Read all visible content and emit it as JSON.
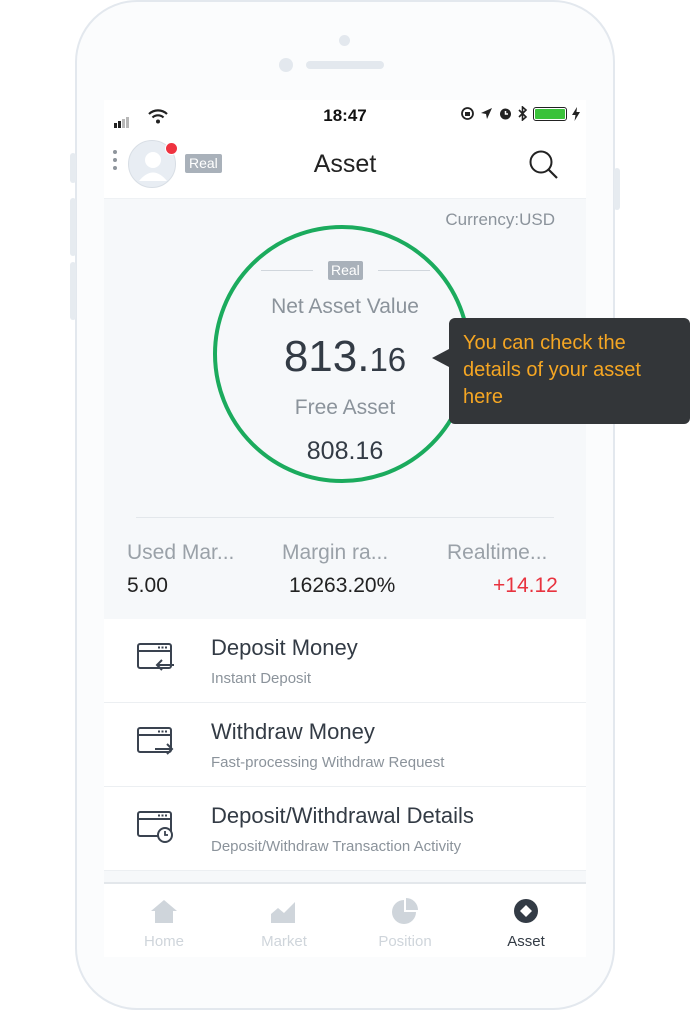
{
  "status_bar": {
    "time": "18:47"
  },
  "nav": {
    "account_badge": "Real",
    "title": "Asset"
  },
  "asset": {
    "currency": "Currency:USD",
    "badge": "Real",
    "net_asset_label": "Net Asset Value",
    "net_asset_int": "813.",
    "net_asset_dec": "16",
    "free_asset_label": "Free Asset",
    "free_asset_value": "808.16",
    "accent_color": "#1bab5d"
  },
  "stats": [
    {
      "label": "Used Mar...",
      "value": "5.00"
    },
    {
      "label": "Margin ra...",
      "value": "16263.20%"
    },
    {
      "label": "Realtime...",
      "value": "+14.12",
      "color": "#e8333f"
    }
  ],
  "tooltip": {
    "text": "You can check the details of your asset here"
  },
  "menu": [
    {
      "title": "Deposit Money",
      "subtitle": "Instant Deposit",
      "icon": "deposit-icon"
    },
    {
      "title": "Withdraw Money",
      "subtitle": "Fast-processing Withdraw Request",
      "icon": "withdraw-icon"
    },
    {
      "title": "Deposit/Withdrawal Details",
      "subtitle": "Deposit/Withdraw Transaction Activity",
      "icon": "details-icon"
    }
  ],
  "tabs": [
    {
      "label": "Home",
      "icon": "home-icon",
      "active": false
    },
    {
      "label": "Market",
      "icon": "market-icon",
      "active": false
    },
    {
      "label": "Position",
      "icon": "position-icon",
      "active": false
    },
    {
      "label": "Asset",
      "icon": "asset-icon",
      "active": true
    }
  ]
}
